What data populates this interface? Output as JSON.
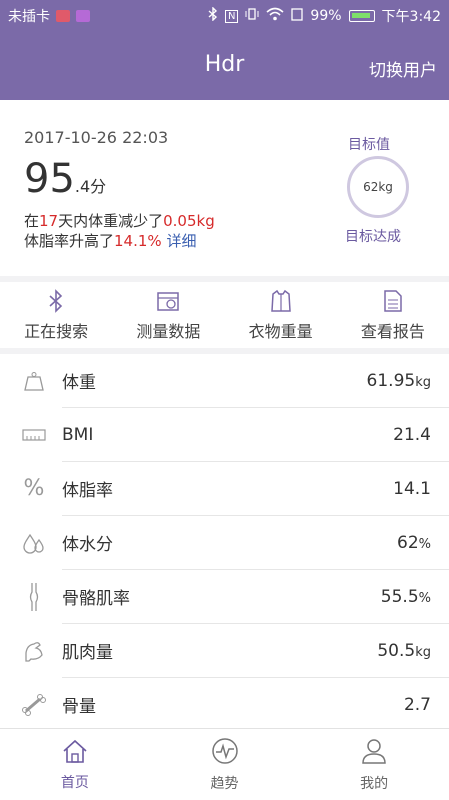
{
  "status_bar": {
    "carrier": "未插卡",
    "battery": "99%",
    "time": "下午3:42",
    "icons": [
      "sim-icon",
      "message-icon",
      "bluetooth-icon",
      "nfc-icon",
      "vibrate-icon",
      "wifi-icon",
      "data-icon",
      "battery-icon"
    ]
  },
  "header": {
    "title": "Hdr",
    "switch_user": "切换用户"
  },
  "summary": {
    "datetime": "2017-10-26 22:03",
    "score_int": "95",
    "score_dec": ".4分",
    "line1_prefix": "在",
    "line1_days": "17",
    "line1_mid": "天内体重减少了",
    "line1_value": "0.05kg",
    "line2_prefix": "体脂率升高了",
    "line2_value": "14.1%",
    "line2_link": "详细",
    "goal_label": "目标值",
    "goal_value": "62kg",
    "goal_reached": "目标达成"
  },
  "actions": [
    {
      "label": "正在搜索",
      "icon": "bluetooth-icon"
    },
    {
      "label": "测量数据",
      "icon": "calendar-icon"
    },
    {
      "label": "衣物重量",
      "icon": "clothes-icon"
    },
    {
      "label": "查看报告",
      "icon": "report-icon"
    }
  ],
  "metrics": [
    {
      "name": "体重",
      "value": "61.95",
      "unit": "kg",
      "icon": "weight-icon"
    },
    {
      "name": "BMI",
      "value": "21.4",
      "unit": "",
      "icon": "bmi-icon"
    },
    {
      "name": "体脂率",
      "value": "14.1",
      "unit": "",
      "icon": "percent-icon"
    },
    {
      "name": "体水分",
      "value": "62",
      "unit": "%",
      "icon": "water-icon"
    },
    {
      "name": "骨骼肌率",
      "value": "55.5",
      "unit": "%",
      "icon": "muscle-rate-icon"
    },
    {
      "name": "肌肉量",
      "value": "50.5",
      "unit": "kg",
      "icon": "muscle-icon"
    },
    {
      "name": "骨量",
      "value": "2.7",
      "unit": "",
      "icon": "bone-icon"
    }
  ],
  "tabs": [
    {
      "label": "首页",
      "icon": "home-icon",
      "active": true
    },
    {
      "label": "趋势",
      "icon": "trend-icon",
      "active": false
    },
    {
      "label": "我的",
      "icon": "profile-icon",
      "active": false
    }
  ],
  "colors": {
    "accent": "#7b6aa8",
    "highlight": "#d62b2b",
    "link": "#3a5fb0"
  }
}
